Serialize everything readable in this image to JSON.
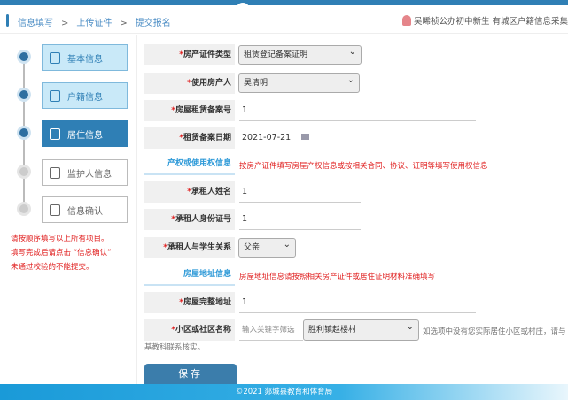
{
  "breadcrumb": {
    "items": [
      "信息填写",
      "上传证件",
      "提交报名"
    ],
    "sep": ">"
  },
  "user": "吴晞祯公办初中新生 有城区户籍信息采集",
  "steps": [
    "基本信息",
    "户籍信息",
    "居住信息",
    "监护人信息",
    "信息确认"
  ],
  "notes": [
    "请按顺序填写以上所有项目。",
    "填写完成后请点击 “信息确认”",
    "未通过校验的不能提交。"
  ],
  "form": {
    "cert_type": {
      "label": "房产证件类型",
      "value": "租赁登记备案证明"
    },
    "user": {
      "label": "使用房产人",
      "value": "吴清明"
    },
    "lease_no": {
      "label": "房屋租赁备案号",
      "value": "1"
    },
    "lease_date": {
      "label": "租赁备案日期",
      "value": "2021-07-21"
    },
    "sec1": {
      "title": "产权或使用权信息",
      "tip": "按房产证件填写房屋产权信息或按相关合同、协议、证明等填写使用权信息"
    },
    "tenant_name": {
      "label": "承租人姓名",
      "value": "1"
    },
    "tenant_id": {
      "label": "承租人身份证号",
      "value": "1"
    },
    "relation": {
      "label": "承租人与学生关系",
      "value": "父亲"
    },
    "sec2": {
      "title": "房屋地址信息",
      "tip": "房屋地址信息请按照相关房产证件或居住证明材料准确填写"
    },
    "address": {
      "label": "房屋完整地址",
      "value": "1"
    },
    "community": {
      "label": "小区或社区名称",
      "placeholder": "输入关键字筛选",
      "value": "胜利镇赵楼村",
      "hint": "如选项中没有您实际居住小区或村庄，请与",
      "hint2": "基教科联系核实。"
    },
    "required_mark": "*"
  },
  "save": "保存",
  "footer": "©2021  郯城县教育和体育局"
}
